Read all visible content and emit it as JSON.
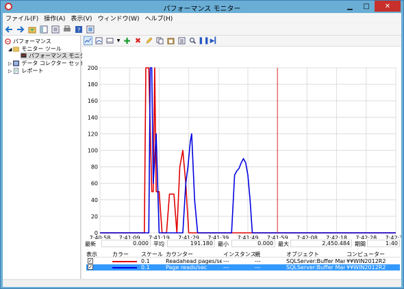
{
  "window": {
    "title": "パフォーマンス モニター",
    "minimize": "▁",
    "maximize": "□",
    "close": "✕"
  },
  "menu": [
    {
      "label": "ファイル(F)"
    },
    {
      "label": "操作(A)"
    },
    {
      "label": "表示(V)"
    },
    {
      "label": "ウィンドウ(W)"
    },
    {
      "label": "ヘルプ(H)"
    }
  ],
  "tree": {
    "root": "パフォーマンス",
    "monitor_tools": "モニター ツール",
    "perf_monitor": "パフォーマンス モニター",
    "data_collector_sets": "データ コレクター セット",
    "reports": "レポート"
  },
  "stats": {
    "last_label": "最新",
    "last_value": "0.000",
    "avg_label": "平均",
    "avg_value": "191.180",
    "min_label": "最小",
    "min_value": "0.000",
    "max_label": "最大",
    "max_value": "2,450.484",
    "duration_label": "期間",
    "duration_value": "1:40"
  },
  "counters": {
    "headers": {
      "show": "表示",
      "color": "カラー",
      "scale": "スケール",
      "counter": "カウンター",
      "instance": "インスタンス",
      "parent": "親",
      "object": "オブジェクト",
      "computer": "コンピューター"
    },
    "rows": [
      {
        "checked": "✓",
        "color": "#e00000",
        "scale": "0.1",
        "counter": "Readahead pages/sec",
        "instance": "---",
        "parent": "---",
        "object": "SQLServer:Buffer Man...",
        "computer": "¥¥WIN2012R2"
      },
      {
        "checked": "✓",
        "color": "#0000e0",
        "scale": "0.1",
        "counter": "Page reads/sec",
        "instance": "---",
        "parent": "---",
        "object": "SQLServer:Buffer Man...",
        "computer": "¥¥WIN2012R2"
      }
    ]
  },
  "chart_data": {
    "type": "line",
    "ylim": [
      0,
      200
    ],
    "yticks": [
      0,
      20,
      40,
      60,
      80,
      100,
      120,
      140,
      160,
      180,
      200
    ],
    "xtick_labels": [
      "7:40:58",
      "7:41:09",
      "7:41:19",
      "7:41:29",
      "7:41:39",
      "7:41:49",
      "7:41:59",
      "7:42:08",
      "7:42:18",
      "7:42:28",
      "7:42:36"
    ],
    "time_cursor": "7:41:59",
    "grid": true,
    "series": [
      {
        "name": "Readahead pages/sec",
        "color": "#e00000",
        "x": [
          0,
          6,
          6.2,
          6.6,
          7.0,
          7.2,
          7.4,
          7.6,
          8.0,
          8.4,
          9.0,
          9.4,
          10.0,
          10.4,
          10.8,
          11.2,
          11.6,
          12.0,
          40
        ],
        "y": [
          0,
          0,
          200,
          200,
          50,
          50,
          200,
          50,
          50,
          0,
          0,
          47,
          47,
          0,
          80,
          100,
          60,
          0,
          0
        ]
      },
      {
        "name": "Page reads/sec",
        "color": "#0000e0",
        "x": [
          0,
          6.6,
          6.8,
          7.0,
          7.2,
          7.6,
          7.8,
          8.0,
          8.3,
          11.2,
          11.6,
          11.9,
          12.2,
          12.4,
          12.8,
          13.2,
          17.8,
          18.2,
          18.5,
          18.8,
          19.1,
          19.4,
          19.7,
          20.0,
          20.3,
          20.6,
          21.0,
          40
        ],
        "y": [
          0,
          0,
          200,
          200,
          60,
          120,
          60,
          0,
          0,
          0,
          60,
          80,
          110,
          120,
          40,
          0,
          0,
          70,
          75,
          78,
          85,
          90,
          85,
          70,
          40,
          0,
          0,
          0
        ]
      }
    ]
  }
}
